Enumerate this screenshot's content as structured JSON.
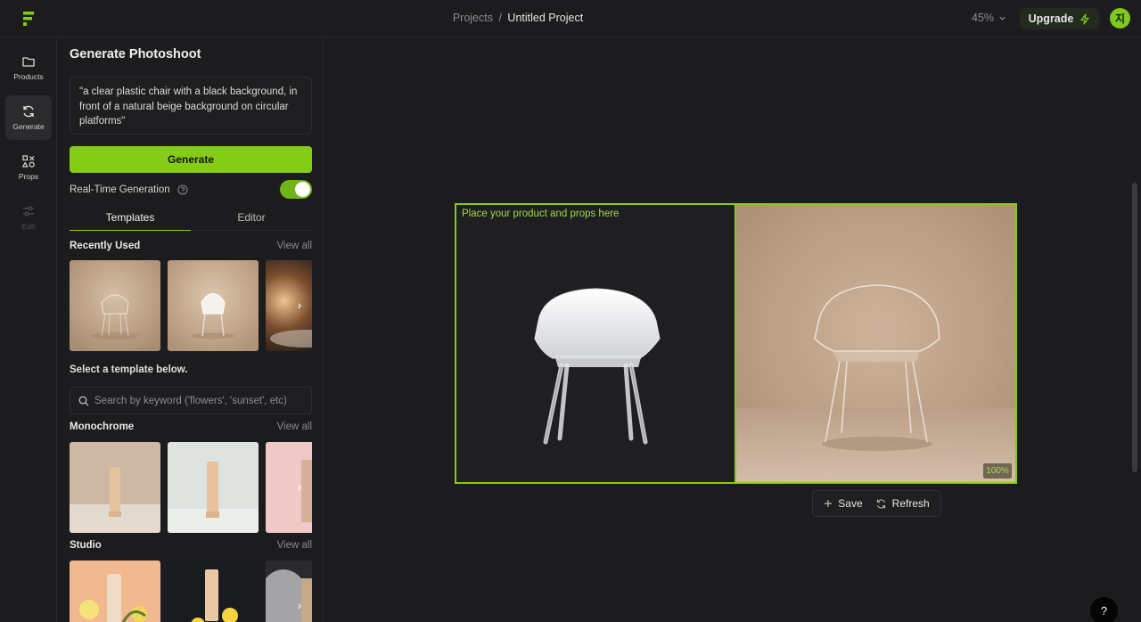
{
  "breadcrumb": {
    "parent": "Projects",
    "separator": "/",
    "current": "Untitled Project"
  },
  "zoom": {
    "level": "45%"
  },
  "upgrade": {
    "label": "Upgrade"
  },
  "user": {
    "initial": "지"
  },
  "rail": {
    "products": "Products",
    "generate": "Generate",
    "props": "Props",
    "edit": "Edit"
  },
  "panel": {
    "title": "Generate Photoshoot",
    "prompt": "\"a clear plastic chair with a black background, in front of a natural beige background on circular platforms\"",
    "generate_label": "Generate",
    "realtime_label": "Real-Time Generation",
    "realtime_on": true,
    "tabs": {
      "templates": "Templates",
      "editor": "Editor"
    },
    "recently_used": {
      "title": "Recently Used",
      "link": "View all"
    },
    "select_label": "Select a template below.",
    "search_placeholder": "Search by keyword ('flowers', 'sunset', etc)",
    "monochrome": {
      "title": "Monochrome",
      "link": "View all"
    },
    "studio": {
      "title": "Studio",
      "link": "View all"
    }
  },
  "canvas": {
    "placeholder_label": "Place your product and props here",
    "result_badge": "100%",
    "save_label": "Save",
    "refresh_label": "Refresh"
  },
  "help": {
    "label": "?"
  },
  "colors": {
    "accent": "#84cc16",
    "bg": "#1c1c1e",
    "beige": "#c9ab8e"
  }
}
